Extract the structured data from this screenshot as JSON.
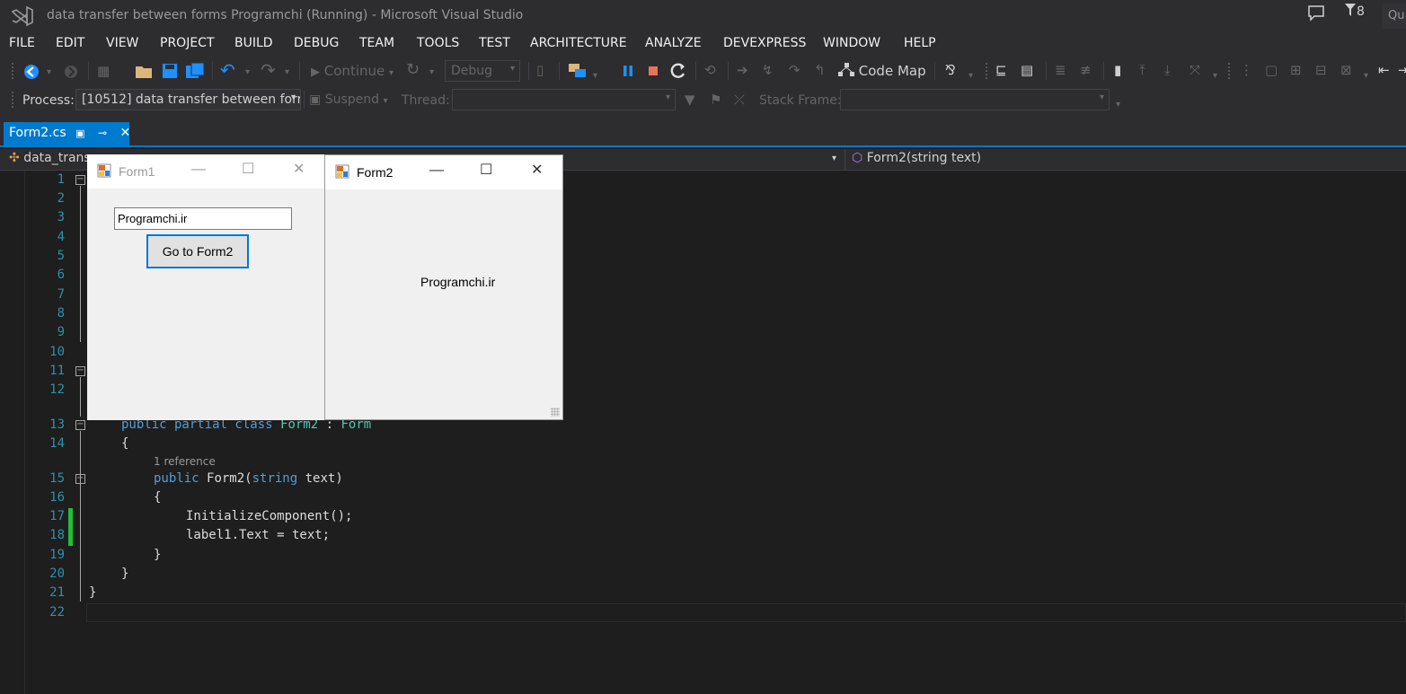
{
  "window": {
    "title": "data transfer between forms Programchi (Running) - Microsoft Visual Studio",
    "notification_count": "8",
    "quick_launch": "Qu"
  },
  "menu": [
    "FILE",
    "EDIT",
    "VIEW",
    "PROJECT",
    "BUILD",
    "DEBUG",
    "TEAM",
    "TOOLS",
    "TEST",
    "ARCHITECTURE",
    "ANALYZE",
    "DEVEXPRESS",
    "WINDOW",
    "HELP"
  ],
  "toolbar": {
    "continue_label": "Continue",
    "config_value": "Debug",
    "code_map_label": "Code Map"
  },
  "debug_bar": {
    "process_label": "Process:",
    "process_value": "[10512] data transfer between forr",
    "suspend_label": "Suspend",
    "thread_label": "Thread:",
    "stack_frame_label": "Stack Frame:"
  },
  "tabs": [
    {
      "label": "Form2.cs",
      "active": true
    }
  ],
  "navbar": {
    "project": "data_trans",
    "member": "Form2(string text)"
  },
  "editor": {
    "line_numbers": [
      "1",
      "2",
      "3",
      "4",
      "5",
      "6",
      "7",
      "8",
      "9",
      "10",
      "11",
      "12",
      "13",
      "14",
      "15",
      "16",
      "17",
      "18",
      "19",
      "20",
      "21",
      "22"
    ],
    "lens_text": "1 reference",
    "code": {
      "l13_kw": "public partial class",
      "l13_type": "Form2",
      "l13_colon": ":",
      "l13_base": "Form",
      "l14": "{",
      "l15_kw": "public",
      "l15_name": "Form2(",
      "l15_type": "string",
      "l15_rest": "text)",
      "l16": "{",
      "l17": "InitializeComponent();",
      "l18": "label1.Text = text;",
      "l19": "}",
      "l20": "}",
      "l21": "}"
    }
  },
  "form1": {
    "title": "Form1",
    "textbox_value": "Programchi.ir",
    "button_label": "Go to Form2"
  },
  "form2": {
    "title": "Form2",
    "label_text": "Programchi.ir"
  },
  "colors": {
    "accent": "#007acc",
    "keyword": "#569cd6",
    "type": "#4ec9b0",
    "line_number": "#2b91af",
    "change_marker": "#1fbf3a"
  }
}
